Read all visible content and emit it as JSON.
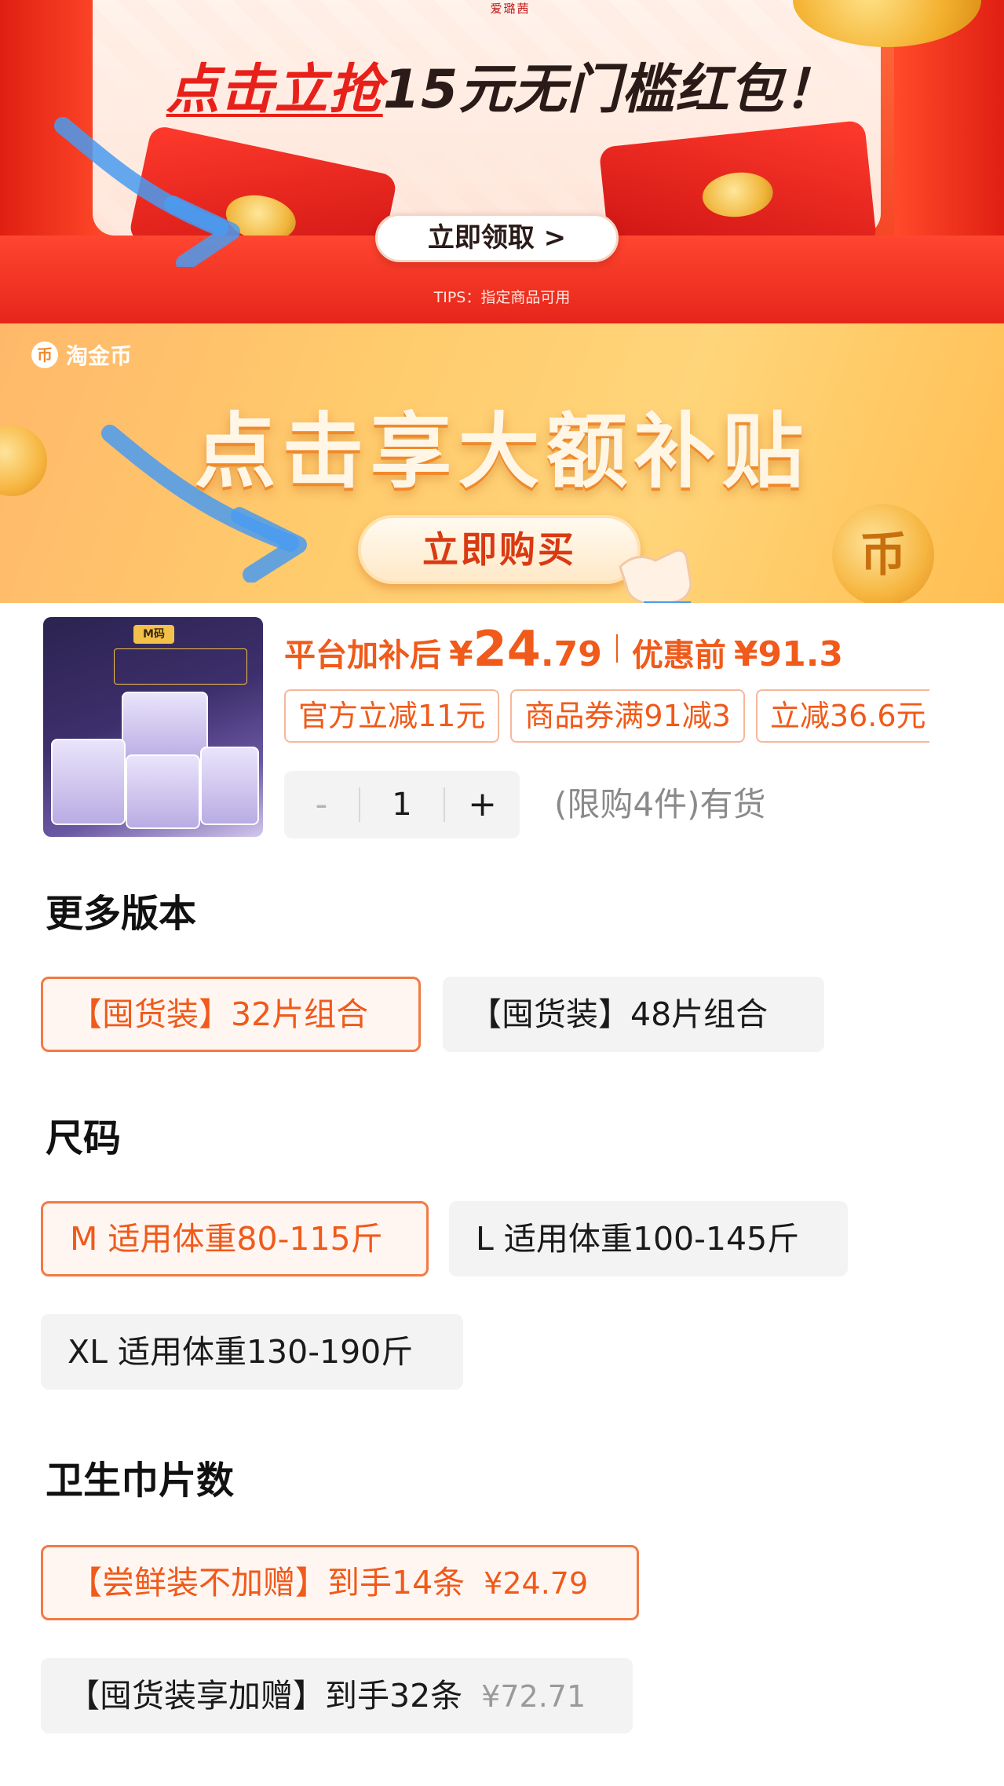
{
  "banner1": {
    "logo_text": "爱璐茜",
    "headline_accent": "点击立抢",
    "headline_rest": "15元无门槛红包！",
    "button_label": "立即领取 >",
    "tips": "TIPS：指定商品可用"
  },
  "banner2": {
    "logo_label": "淘金币",
    "logo_icon": "币",
    "headline": "点击享大额补贴",
    "button_label": "立即购买",
    "coin_glyph": "币"
  },
  "product": {
    "thumb_tag": "M码",
    "price_label": "平台加补后",
    "currency": "¥",
    "price_int": "24",
    "price_dec": ".79",
    "orig_label": "优惠前",
    "orig_price": "¥91.3",
    "promos": [
      "官方立减11元",
      "商品券满91减3",
      "立减36.6元"
    ],
    "quantity": "1",
    "qty_minus": "-",
    "qty_plus": "+",
    "stock_text": "(限购4件)有货"
  },
  "sections": {
    "versions": {
      "title": "更多版本",
      "options": [
        "【囤货装】32片组合",
        "【囤货装】48片组合"
      ],
      "selected_index": 0
    },
    "sizes": {
      "title": "尺码",
      "options": [
        "M 适用体重80-115斤",
        "L 适用体重100-145斤",
        "XL 适用体重130-190斤"
      ],
      "selected_index": 0
    },
    "counts": {
      "title": "卫生巾片数",
      "options": [
        {
          "label": "【尝鲜装不加赠】到手14条",
          "price": "¥24.79"
        },
        {
          "label": "【囤货装享加赠】到手32条",
          "price": "¥72.71"
        }
      ],
      "selected_index": 0
    }
  },
  "colors": {
    "accent": "#f05a1a",
    "selected_border": "#f27a44",
    "banner_red": "#f23a1e",
    "banner_orange": "#ffcb6c",
    "arrow_blue": "#4a9bf0"
  }
}
